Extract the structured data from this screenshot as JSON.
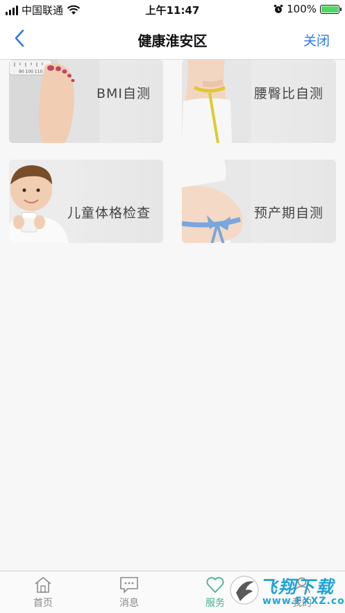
{
  "status_bar": {
    "carrier": "中国联通",
    "time": "上午11:47",
    "battery": "100%",
    "battery_level": 1.0,
    "icons": [
      "signal-icon",
      "wifi-icon",
      "alarm-icon",
      "battery-icon"
    ]
  },
  "nav": {
    "title": "健康淮安区",
    "close_label": "关闭",
    "back_icon": "back-chevron-icon",
    "accent": "#2d7be5"
  },
  "cards": [
    {
      "label": "BMI自测",
      "image": "scale-feet-image"
    },
    {
      "label": "腰臀比自测",
      "image": "waist-measure-image"
    },
    {
      "label": "儿童体格检查",
      "image": "child-milk-image"
    },
    {
      "label": "预产期自测",
      "image": "pregnant-belly-ribbon-image"
    }
  ],
  "tabbar": {
    "items": [
      {
        "label": "首页",
        "icon": "home-icon",
        "active": false
      },
      {
        "label": "消息",
        "icon": "message-icon",
        "active": false
      },
      {
        "label": "服务",
        "icon": "heart-icon",
        "active": true
      },
      {
        "label": "我的",
        "icon": "user-icon",
        "active": false
      }
    ],
    "active_color": "#4ab38f",
    "inactive_color": "#8a8a8a"
  },
  "watermark": {
    "text": "飞翔下载",
    "url": "www.FXXZ.com"
  }
}
